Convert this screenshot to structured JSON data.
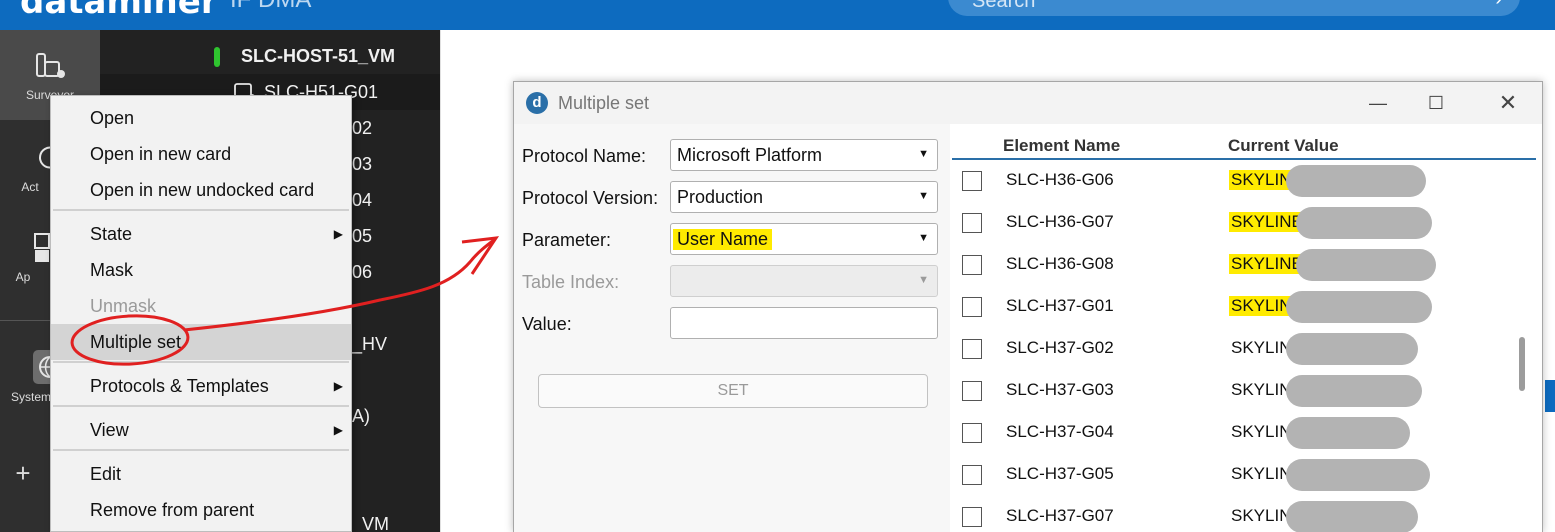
{
  "header": {
    "logo": "dataminer",
    "app_name": "IF DMA",
    "search_placeholder": "Search",
    "search_go": "›"
  },
  "sidebar": {
    "items": [
      {
        "label": "Surveyor",
        "icon": "surveyor-icon"
      },
      {
        "label": "Act",
        "icon": "activity-icon"
      },
      {
        "label": "Ap",
        "icon": "apps-icon"
      },
      {
        "label": "System",
        "icon": "globe-icon"
      },
      {
        "label": "+",
        "icon": "add-icon"
      }
    ]
  },
  "tree": {
    "rows": [
      {
        "text": "SLC-HOST-51_VM"
      },
      {
        "text": "SLC-H51-G01"
      },
      {
        "text": "02"
      },
      {
        "text": "03"
      },
      {
        "text": "04"
      },
      {
        "text": "05"
      },
      {
        "text": "06"
      },
      {
        "text": "_HV"
      },
      {
        "text": "A)"
      },
      {
        "text": "_VM"
      }
    ]
  },
  "context_menu": {
    "items": [
      {
        "label": "Open"
      },
      {
        "label": "Open in new card"
      },
      {
        "label": "Open in new undocked card"
      },
      {
        "label": "State"
      },
      {
        "label": "Mask"
      },
      {
        "label": "Unmask"
      },
      {
        "label": "Multiple set"
      },
      {
        "label": "Protocols & Templates"
      },
      {
        "label": "View"
      },
      {
        "label": "Edit"
      },
      {
        "label": "Remove from parent"
      }
    ]
  },
  "dialog": {
    "title": "Multiple set",
    "logo_letter": "d",
    "fields": {
      "protocol_name_label": "Protocol Name:",
      "protocol_name_value": "Microsoft Platform",
      "protocol_version_label": "Protocol Version:",
      "protocol_version_value": "Production",
      "parameter_label": "Parameter:",
      "parameter_value": "User Name",
      "table_index_label": "Table Index:",
      "value_label": "Value:"
    },
    "set_button": "SET",
    "table": {
      "headers": [
        "Element Name",
        "Current Value"
      ],
      "rows": [
        {
          "name": "SLC-H36-G06",
          "value": "SKYLIN"
        },
        {
          "name": "SLC-H36-G07",
          "value": "SKYLINE"
        },
        {
          "name": "SLC-H36-G08",
          "value": "SKYLINE"
        },
        {
          "name": "SLC-H37-G01",
          "value": "SKYLIN"
        },
        {
          "name": "SLC-H37-G02",
          "value": "SKYLIN"
        },
        {
          "name": "SLC-H37-G03",
          "value": "SKYLIN"
        },
        {
          "name": "SLC-H37-G04",
          "value": "SKYLIN"
        },
        {
          "name": "SLC-H37-G05",
          "value": "SKYLIN"
        },
        {
          "name": "SLC-H37-G07",
          "value": "SKYLIN"
        }
      ]
    }
  },
  "colors": {
    "header_blue": "#0d6bbf",
    "highlight_yellow": "#ffeb00",
    "annotation_red": "#e02020"
  }
}
